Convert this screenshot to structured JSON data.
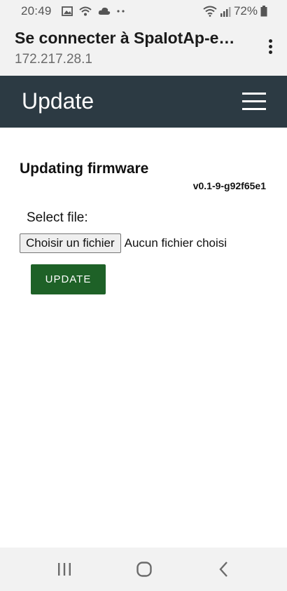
{
  "status_bar": {
    "time": "20:49",
    "battery": "72%",
    "icons": [
      "image-icon",
      "wifi-calling-icon",
      "cloud-icon",
      "more-notifications-icon",
      "wifi-icon",
      "signal-icon",
      "battery-icon"
    ]
  },
  "browser": {
    "title": "Se connecter à SpaIotAp-e…",
    "url": "172.217.28.1",
    "menu_icon": "more-vert-icon"
  },
  "app_header": {
    "title": "Update",
    "menu_icon": "hamburger-menu-icon",
    "background": "#2c3a43"
  },
  "content": {
    "heading": "Updating firmware",
    "version": "v0.1-9-g92f65e1",
    "select_label": "Select file:",
    "file_button_label": "Choisir un fichier",
    "file_status": "Aucun fichier choisi",
    "update_button_label": "UPDATE",
    "update_button_color": "#1e6127"
  },
  "nav_bar": {
    "icons": [
      "recent-apps-icon",
      "home-icon",
      "back-icon"
    ]
  }
}
